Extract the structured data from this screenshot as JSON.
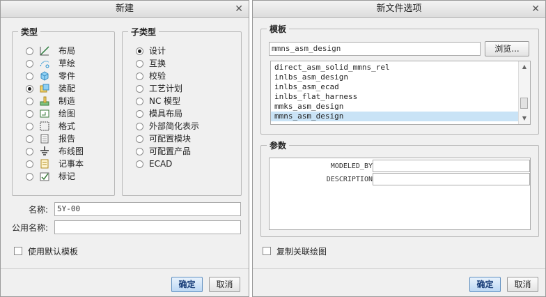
{
  "new_dialog": {
    "title": "新建",
    "type_group_title": "类型",
    "types": [
      {
        "label": "布局",
        "icon": "layout-icon",
        "selected": false
      },
      {
        "label": "草绘",
        "icon": "sketch-icon",
        "selected": false
      },
      {
        "label": "零件",
        "icon": "part-icon",
        "selected": false
      },
      {
        "label": "装配",
        "icon": "assembly-icon",
        "selected": true
      },
      {
        "label": "制造",
        "icon": "manufacturing-icon",
        "selected": false
      },
      {
        "label": "绘图",
        "icon": "drawing-icon",
        "selected": false
      },
      {
        "label": "格式",
        "icon": "format-icon",
        "selected": false
      },
      {
        "label": "报告",
        "icon": "report-icon",
        "selected": false
      },
      {
        "label": "布线图",
        "icon": "diagram-icon",
        "selected": false
      },
      {
        "label": "记事本",
        "icon": "notebook-icon",
        "selected": false
      },
      {
        "label": "标记",
        "icon": "markup-icon",
        "selected": false
      }
    ],
    "subtype_group_title": "子类型",
    "subtypes": [
      {
        "label": "设计",
        "selected": true
      },
      {
        "label": "互换",
        "selected": false
      },
      {
        "label": "校验",
        "selected": false
      },
      {
        "label": "工艺计划",
        "selected": false
      },
      {
        "label": "NC 模型",
        "selected": false
      },
      {
        "label": "模具布局",
        "selected": false
      },
      {
        "label": "外部简化表示",
        "selected": false
      },
      {
        "label": "可配置模块",
        "selected": false
      },
      {
        "label": "可配置产品",
        "selected": false
      },
      {
        "label": "ECAD",
        "selected": false
      }
    ],
    "name_label": "名称:",
    "name_value": "5Y-00",
    "common_name_label": "公用名称:",
    "common_name_value": "",
    "use_default_template_label": "使用默认模板",
    "use_default_template_checked": false,
    "ok_label": "确定",
    "cancel_label": "取消"
  },
  "options_dialog": {
    "title": "新文件选项",
    "template_group_title": "模板",
    "template_value": "mmns_asm_design",
    "browse_label": "浏览...",
    "templates": [
      {
        "label": "direct_asm_solid_mmns_rel",
        "selected": false
      },
      {
        "label": "inlbs_asm_design",
        "selected": false
      },
      {
        "label": "inlbs_asm_ecad",
        "selected": false
      },
      {
        "label": "inlbs_flat_harness",
        "selected": false
      },
      {
        "label": "mmks_asm_design",
        "selected": false
      },
      {
        "label": "mmns_asm_design",
        "selected": true
      }
    ],
    "params_group_title": "参数",
    "params": [
      {
        "name": "MODELED_BY",
        "value": ""
      },
      {
        "name": "DESCRIPTION",
        "value": ""
      }
    ],
    "copy_drawing_label": "复制关联绘图",
    "copy_drawing_checked": false,
    "ok_label": "确定",
    "cancel_label": "取消"
  },
  "colors": {
    "dialog_bg": "#f0f0f0",
    "selection_bg": "#c9e3f6",
    "primary_button": "#bcd8f4"
  }
}
